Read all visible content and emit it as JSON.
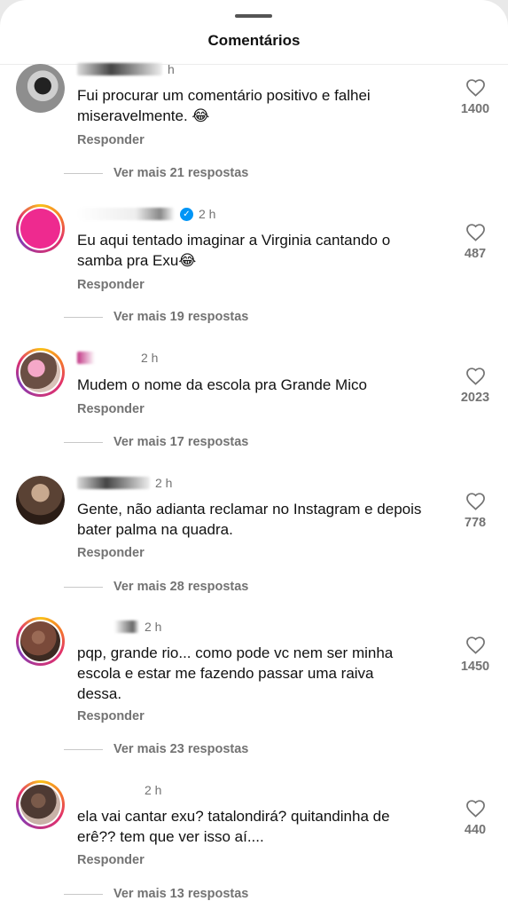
{
  "header": {
    "title": "Comentários"
  },
  "labels": {
    "reply": "Responder"
  },
  "comments": [
    {
      "time": "h",
      "text": "Fui procurar um comentário positivo e falhei miseravelmente. 😂",
      "likes": "1400",
      "more": "Ver mais 21 respostas",
      "verified": false,
      "avatar_color": "#9a9a9a",
      "ring": false
    },
    {
      "time": "2 h",
      "text": "Eu aqui tentado imaginar a Virginia cantando o samba pra Exu😂",
      "likes": "487",
      "more": "Ver mais 19 respostas",
      "verified": true,
      "avatar_color": "#ee2a8f",
      "ring": true
    },
    {
      "time": "2 h",
      "text": "Mudem o nome da escola pra Grande Mico",
      "likes": "2023",
      "more": "Ver mais 17 respostas",
      "verified": false,
      "avatar_color": "#8b6b5b",
      "ring": true
    },
    {
      "time": "2 h",
      "text": "Gente, não adianta reclamar no Instagram e depois bater palma na quadra.",
      "likes": "778",
      "more": "Ver mais 28 respostas",
      "verified": false,
      "avatar_color": "#5a4234",
      "ring": false
    },
    {
      "time": "2 h",
      "text": "pqp, grande rio... como pode vc nem ser minha escola e estar me fazendo passar uma raiva dessa.",
      "likes": "1450",
      "more": "Ver mais 23 respostas",
      "verified": false,
      "avatar_color": "#7a4a3a",
      "ring": true
    },
    {
      "time": "2 h",
      "text": "ela vai cantar exu? tatalondirá? quitandinha de erê?? tem que ver isso aí....",
      "likes": "440",
      "more": "Ver mais 13 respostas",
      "verified": false,
      "avatar_color": "#4e3a33",
      "ring": true
    }
  ]
}
